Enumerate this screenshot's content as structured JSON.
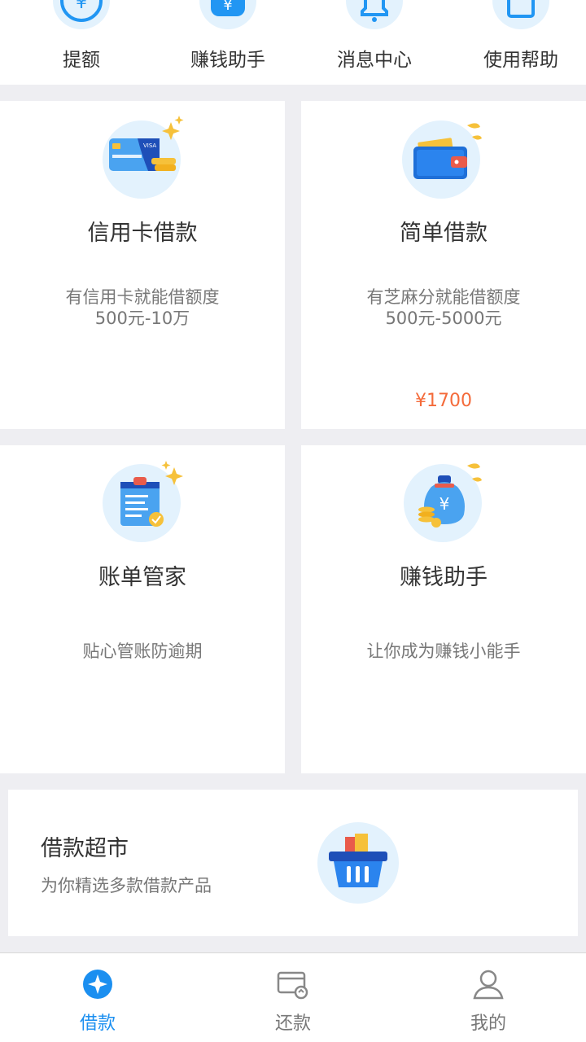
{
  "quick_menu": [
    {
      "label": "提额",
      "icon": "raise-limit-icon"
    },
    {
      "label": "赚钱助手",
      "icon": "money-bag-icon"
    },
    {
      "label": "消息中心",
      "icon": "bell-icon"
    },
    {
      "label": "使用帮助",
      "icon": "help-book-icon"
    }
  ],
  "cards": {
    "credit_card_loan": {
      "title": "信用卡借款",
      "subtitle": "有信用卡就能借额度",
      "range": "500元-10万"
    },
    "simple_loan": {
      "title": "简单借款",
      "subtitle": "有芝麻分就能借额度",
      "range": "500元-5000元",
      "price": "¥1700"
    },
    "bill_manager": {
      "title": "账单管家",
      "subtitle": "贴心管账防逾期"
    },
    "earn_assistant": {
      "title": "赚钱助手",
      "subtitle": "让你成为赚钱小能手"
    }
  },
  "market": {
    "title": "借款超市",
    "subtitle": "为你精选多款借款产品"
  },
  "tabs": [
    {
      "label": "借款",
      "active": true
    },
    {
      "label": "还款",
      "active": false
    },
    {
      "label": "我的",
      "active": false
    }
  ],
  "colors": {
    "accent": "#1b8ff0",
    "price": "#f46b3b",
    "icon_bg": "#e3f2fd",
    "background": "#eeeef2"
  }
}
